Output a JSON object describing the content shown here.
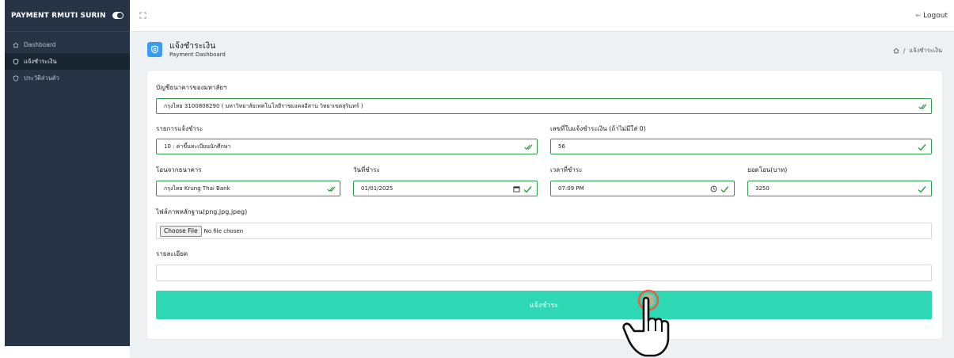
{
  "app": {
    "brand": "PAYMENT RMUTI SURIN"
  },
  "sidebar": {
    "items": [
      {
        "label": "Dashboard"
      },
      {
        "label": "แจ้งชำระเงิน"
      },
      {
        "label": "ประวัติส่วนตัว"
      }
    ]
  },
  "topbar": {
    "logout_label": "Logout"
  },
  "page": {
    "title": "แจ้งชำระเงิน",
    "subtitle": "Payment Dashboard",
    "breadcrumb_sep": "/",
    "breadcrumb_current": "แจ้งชำระเงิน"
  },
  "form": {
    "bank_account": {
      "label": "บัญชีธนาคารของมหาลัยฯ",
      "value": "กรุงไทย 3100808290 ( มหาวิทยาลัยเทคโนโลยีราชมงคลอีสาน วิทยาเขตสุรินทร์ )"
    },
    "payment_item": {
      "label": "รายการแจ้งชำระ",
      "value": "10 : ค่าขึ้นทะเบียนนักศึกษา"
    },
    "receipt_no": {
      "label": "เลขที่ใบแจ้งชำระเงิน (ถ้าไม่มีใส่ 0)",
      "value": "56"
    },
    "from_bank": {
      "label": "โอนจากธนาคาร",
      "value": "กรุงไทย Krung Thai Bank"
    },
    "pay_date": {
      "label": "วันที่ชำระ",
      "value": "01/01/2025"
    },
    "pay_time": {
      "label": "เวลาที่ชำระ",
      "value": "07:09 PM"
    },
    "amount": {
      "label": "ยอดโอน(บาท)",
      "value": "3250"
    },
    "evidence_file": {
      "label": "ไฟล์ภาพหลักฐาน(png,jpg,jpeg)",
      "button_label": "Choose File",
      "status": "No file chosen"
    },
    "details": {
      "label": "รายละเอียด",
      "value": ""
    },
    "submit_label": "แจ้งชำระ"
  },
  "colors": {
    "sidebar_bg": "#263445",
    "accent_blue": "#3a9bf3",
    "valid_green": "#2c9a4a",
    "submit_bg": "#2ed8b4"
  }
}
